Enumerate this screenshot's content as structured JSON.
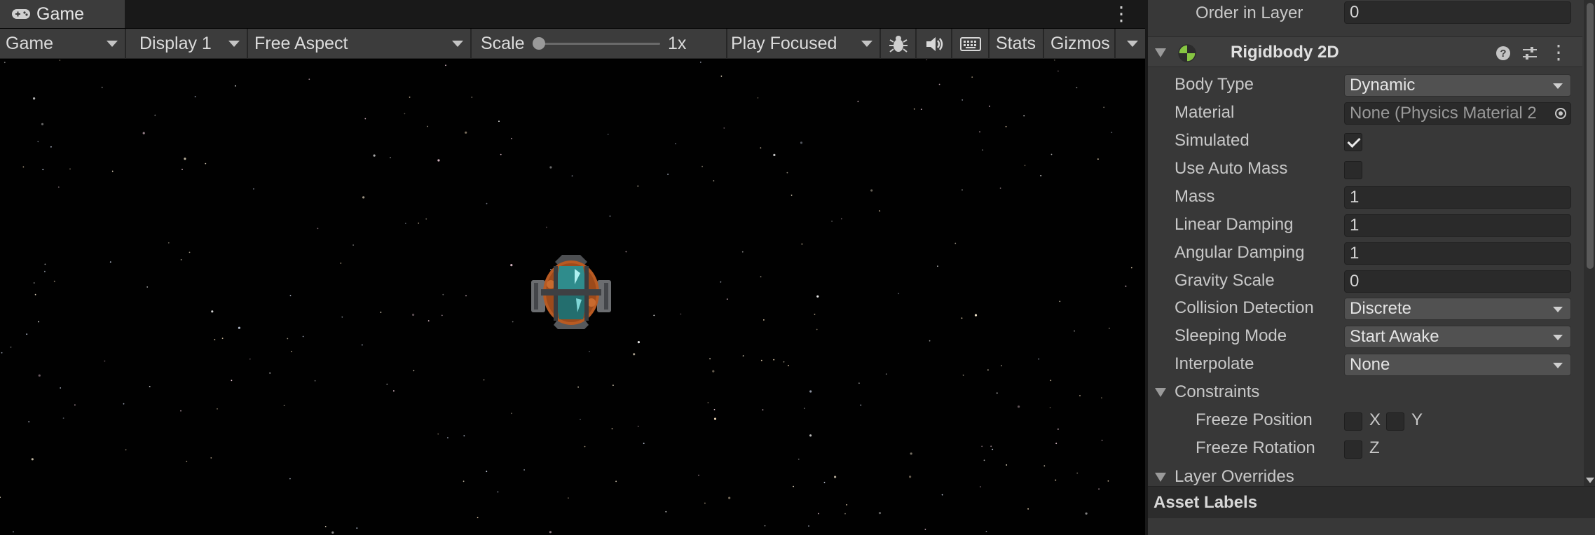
{
  "game_view": {
    "tab_label": "Game",
    "tab_icon": "gamepad-icon",
    "toolbar": {
      "view_mode": "Game",
      "display": "Display 1",
      "aspect": "Free Aspect",
      "scale_label": "Scale",
      "scale_value": "1x",
      "scale_slider_fraction": 0.0,
      "play_mode": "Play Focused",
      "stats_label": "Stats",
      "gizmos_label": "Gizmos"
    }
  },
  "inspector": {
    "order_in_layer": {
      "label": "Order in Layer",
      "value": "0"
    },
    "component": {
      "title": "Rigidbody 2D",
      "icon": "rigidbody-2d-icon"
    },
    "fields": {
      "body_type": {
        "label": "Body Type",
        "value": "Dynamic"
      },
      "material": {
        "label": "Material",
        "value": "None (Physics Material 2"
      },
      "simulated": {
        "label": "Simulated",
        "checked": true
      },
      "use_auto_mass": {
        "label": "Use Auto Mass",
        "checked": false
      },
      "mass": {
        "label": "Mass",
        "value": "1"
      },
      "linear_damping": {
        "label": "Linear Damping",
        "value": "1"
      },
      "angular_damping": {
        "label": "Angular Damping",
        "value": "1"
      },
      "gravity_scale": {
        "label": "Gravity Scale",
        "value": "0"
      },
      "collision_detection": {
        "label": "Collision Detection",
        "value": "Discrete"
      },
      "sleeping_mode": {
        "label": "Sleeping Mode",
        "value": "Start Awake"
      },
      "interpolate": {
        "label": "Interpolate",
        "value": "None"
      }
    },
    "constraints": {
      "label": "Constraints",
      "freeze_position": {
        "label": "Freeze Position",
        "x_label": "X",
        "y_label": "Y",
        "x": false,
        "y": false
      },
      "freeze_rotation": {
        "label": "Freeze Rotation",
        "z_label": "Z",
        "z": false
      }
    },
    "layer_overrides_label": "Layer Overrides",
    "asset_labels": "Asset Labels"
  },
  "colors": {
    "panel_bg": "#383838",
    "toolbar_bg": "#3c3c3c",
    "game_bg": "#010101",
    "field_bg": "#2a2a2a",
    "dropdown_bg": "#515151",
    "ship_hull": "#b85a22",
    "ship_cockpit": "#2f8c8c"
  }
}
